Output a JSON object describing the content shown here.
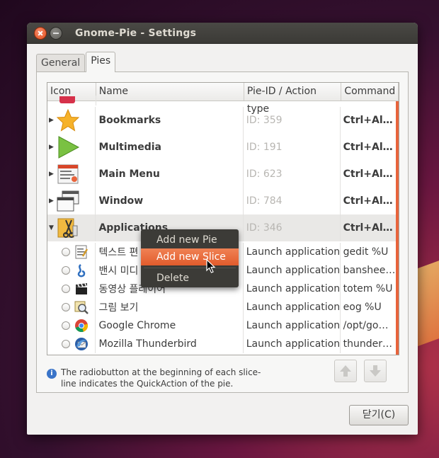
{
  "window": {
    "title": "Gnome-Pie - Settings"
  },
  "tabs": [
    {
      "label": "General"
    },
    {
      "label": "Pies"
    }
  ],
  "columns": {
    "icon": "Icon",
    "name": "Name",
    "pid": "Pie-ID / Action type",
    "command": "Command"
  },
  "pies": [
    {
      "name": "Bookmarks",
      "pid": "ID: 359",
      "command": "Ctrl+Al…",
      "icon": "star-icon",
      "expander": "▶"
    },
    {
      "name": "Multimedia",
      "pid": "ID: 191",
      "command": "Ctrl+Al…",
      "icon": "play-icon",
      "expander": "▶"
    },
    {
      "name": "Main Menu",
      "pid": "ID: 623",
      "command": "Ctrl+Al…",
      "icon": "menu-icon",
      "expander": "▶"
    },
    {
      "name": "Window",
      "pid": "ID: 784",
      "command": "Ctrl+Al…",
      "icon": "window-icon",
      "expander": "▶"
    },
    {
      "name": "Applications",
      "pid": "ID: 346",
      "command": "Ctrl+Al…",
      "icon": "apps-icon",
      "expander": "▼"
    }
  ],
  "slices": [
    {
      "name": "텍스트 편",
      "action": "Launch application",
      "command": "gedit %U",
      "icon": "text-editor-icon"
    },
    {
      "name": "밴시 미디",
      "action": "Launch application",
      "command": "banshee…",
      "icon": "banshee-icon"
    },
    {
      "name": "동영상 플레이어",
      "action": "Launch application",
      "command": "totem %U",
      "icon": "clapper-icon"
    },
    {
      "name": "그림 보기",
      "action": "Launch application",
      "command": "eog %U",
      "icon": "image-viewer-icon"
    },
    {
      "name": "Google Chrome",
      "action": "Launch application",
      "command": "/opt/go…",
      "icon": "chrome-icon"
    },
    {
      "name": "Mozilla Thunderbird",
      "action": "Launch application",
      "command": "thunder…",
      "icon": "thunderbird-icon"
    }
  ],
  "context_menu": {
    "add_pie": "Add new Pie",
    "add_slice": "Add new Slice",
    "delete": "Delete"
  },
  "info": {
    "text": "The radiobutton at the beginning of each slice-line indicates the QuickAction of the pie."
  },
  "buttons": {
    "close": "닫기(C)"
  },
  "colors": {
    "accent": "#e8643c",
    "titlebar": "#3c3b37",
    "menu": "#3c3b37"
  }
}
